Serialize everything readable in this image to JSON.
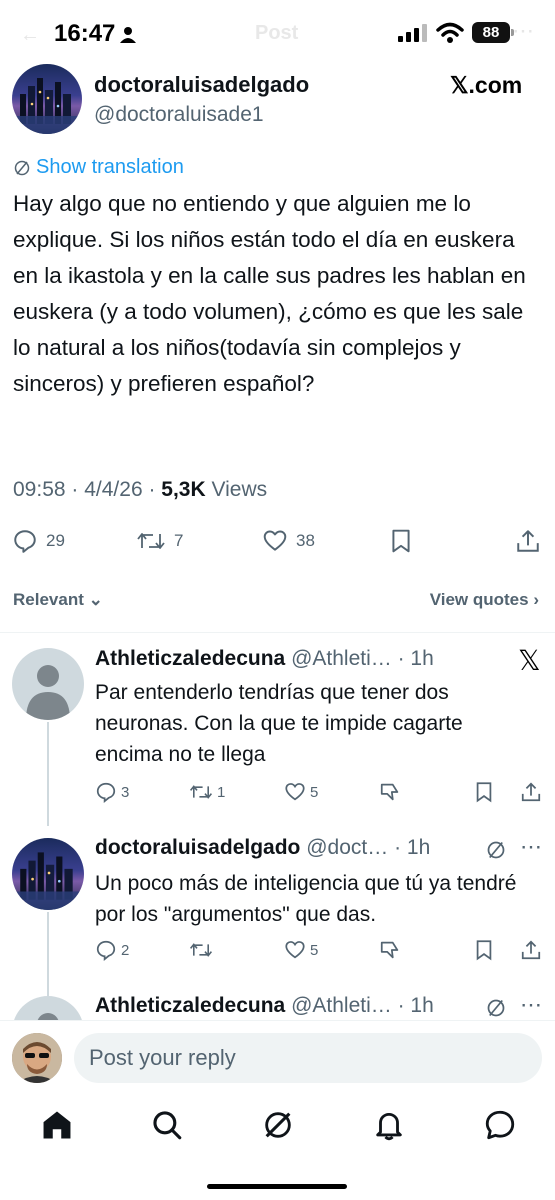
{
  "status_bar": {
    "time": "16:47",
    "header_ghost": "Post",
    "battery": "88"
  },
  "post": {
    "author_name": "doctoraluisadelgado",
    "author_handle": "@doctoraluisade1",
    "watermark": "𝕏.com",
    "show_translation": "Show translation",
    "text": "Hay algo que no entiendo y que alguien me lo explique. Si los niños están todo el día en euskera en la ikastola y en la calle sus padres les hablan en euskera (y a todo volumen), ¿cómo es que les sale lo natural a los niños(todavía sin complejos y sinceros) y prefieren español?",
    "time": "09:58",
    "date": "4/4/26",
    "views_count": "5,3K",
    "views_label": "Views",
    "replies": "29",
    "reposts": "7",
    "likes": "38"
  },
  "sort": {
    "relevant_label": "Relevant",
    "view_quotes_label": "View quotes"
  },
  "replies": [
    {
      "name": "Athleticzaledecuna",
      "handle": "@Athleti…",
      "age": "· 1h",
      "text": "Par entenderlo tendrías que tener dos neuronas. Con la que te impide cagarte encima no te llega",
      "replies": "3",
      "reposts": "1",
      "likes": "5"
    },
    {
      "name": "doctoraluisadelgado",
      "handle": "@doct…",
      "age": "· 1h",
      "text": "Un poco más de inteligencia que tú ya tendré por los \"argumentos\" que das.",
      "replies": "2",
      "reposts": "",
      "likes": "5"
    },
    {
      "name": "Athleticzaledecuna",
      "handle": "@Athleti…",
      "age": "· 1h"
    }
  ],
  "reply_bar": {
    "placeholder": "Post your reply"
  },
  "tabs": [
    "home-icon",
    "search-icon",
    "grok-icon",
    "notifications-icon",
    "messages-icon"
  ],
  "colors": {
    "link": "#1d9bf0",
    "muted": "#536471",
    "text": "#0f1419"
  }
}
